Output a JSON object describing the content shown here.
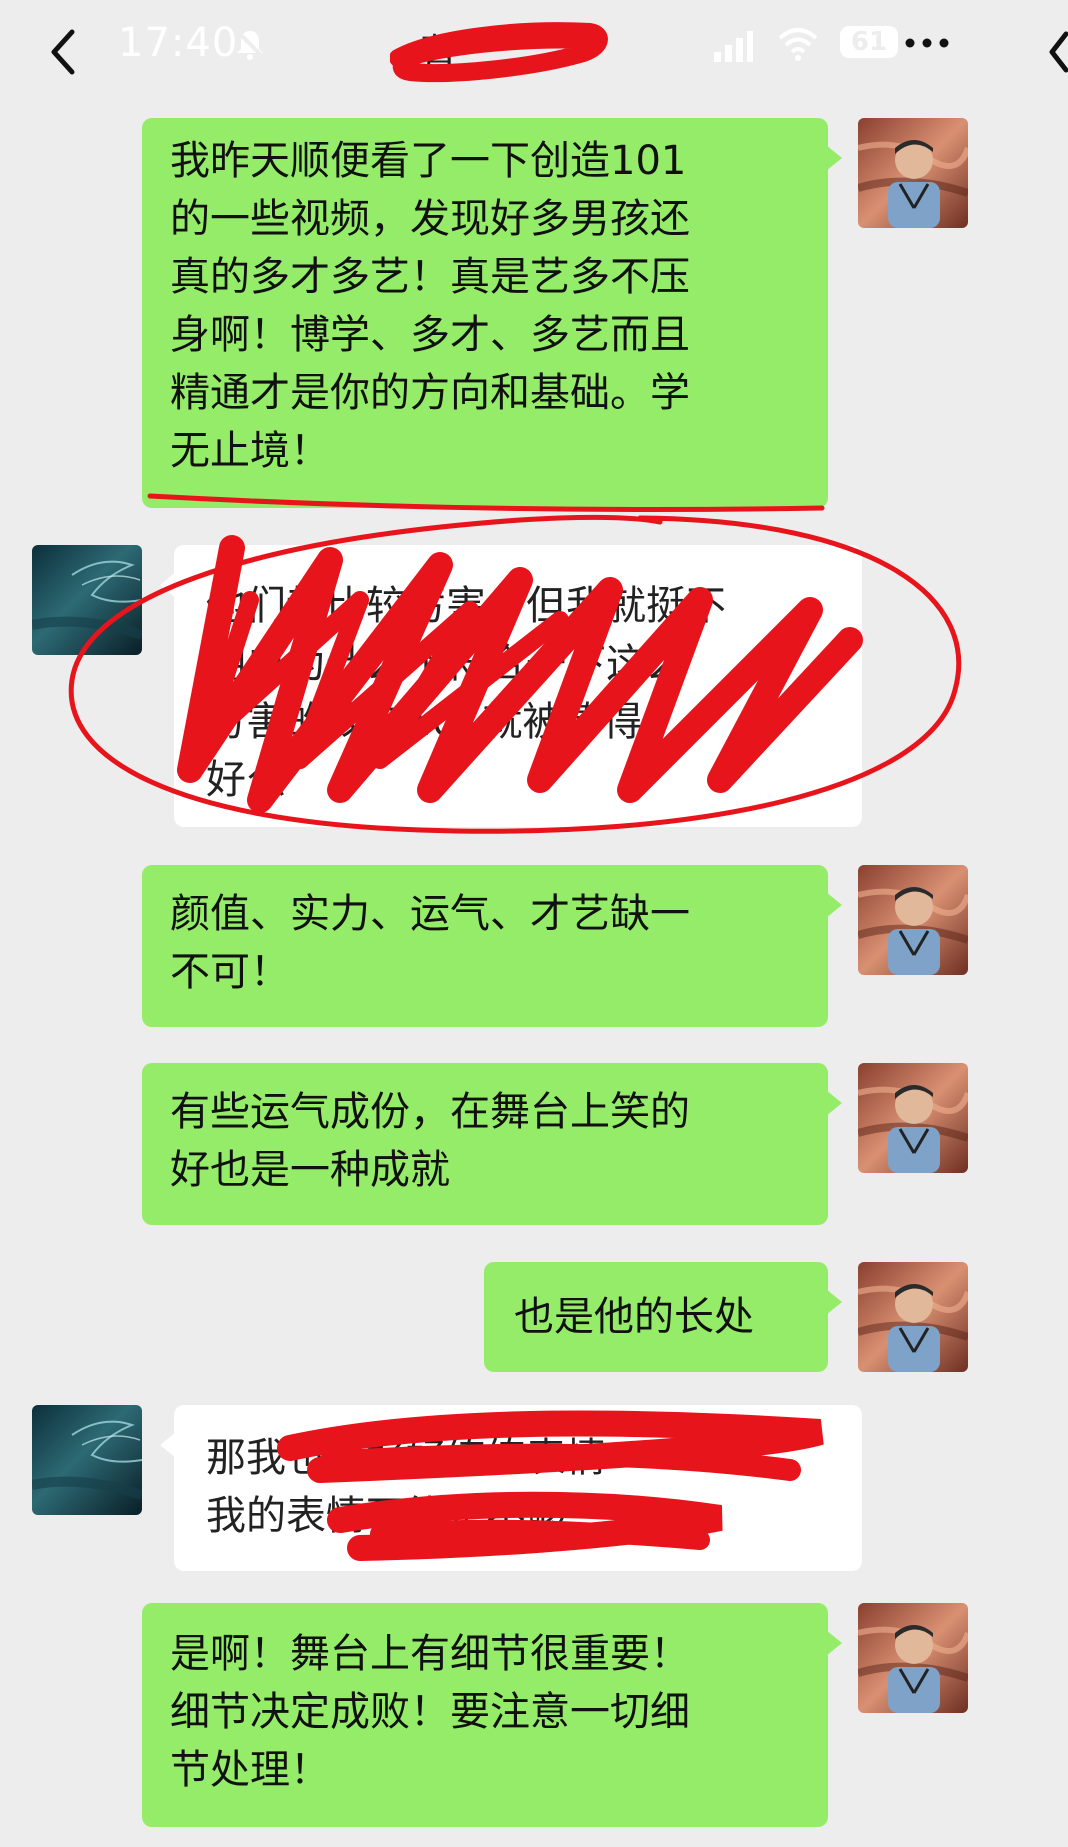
{
  "status_bar": {
    "time": "17:40",
    "battery": "61",
    "chat_title": "曹"
  },
  "messages": [
    {
      "side": "user",
      "text": "我昨天顺便看了一下创造101\n的一些视频，发现好多男孩还\n真的多才多艺！真是艺多不压\n身啊！博学、多才、多艺而且\n精通才是你的方向和基础。学\n无止境！"
    },
    {
      "side": "other",
      "text": "他们都比较厉害，但我就挺不\n明白为什么不符合一下这么\n厉害的我在101就被捧得\n好么",
      "redacted": true
    },
    {
      "side": "user",
      "text": "颜值、实力、运气、才艺缺一\n不可！"
    },
    {
      "side": "user",
      "text": "有些运气成份，在舞台上笑的\n好也是一种成就"
    },
    {
      "side": "user",
      "text": "也是他的长处"
    },
    {
      "side": "other",
      "text": "那我也要好好练练表情\n我的表情可能是不够",
      "redacted": true
    },
    {
      "side": "user",
      "text": "是啊！舞台上有细节很重要！\n细节决定成败！要注意一切细\n节处理！"
    }
  ],
  "colors": {
    "background": "#ededed",
    "sent_bubble": "#95ec69",
    "received_bubble": "#ffffff",
    "annotation_red": "#e8141c"
  },
  "icons": [
    "back-icon",
    "bell-mute-icon",
    "signal-icon",
    "wifi-icon",
    "battery-icon",
    "more-icon"
  ]
}
